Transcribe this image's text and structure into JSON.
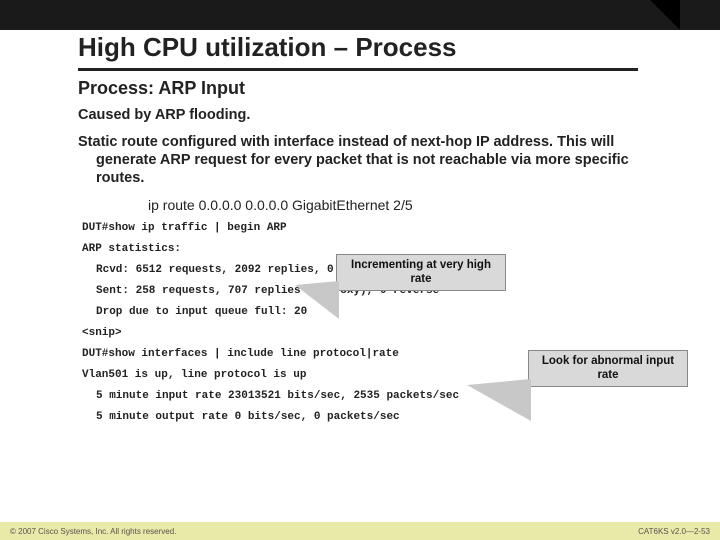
{
  "title": "High CPU utilization – Process",
  "subhead": "Process: ARP Input",
  "caused_by": "Caused by ARP flooding.",
  "static_route_para": "Static route configured with interface instead of next-hop IP address. This will generate ARP request for every packet that is not reachable via more specific routes.",
  "ip_route_cmd": "ip route 0.0.0.0 0.0.0.0 GigabitEthernet 2/5",
  "terminal": {
    "l1": "DUT#show ip traffic | begin ARP",
    "l2": "ARP statistics:",
    "l3": "Rcvd: 6512 requests, 2092 replies, 0 reverse, 0 other",
    "l4": "Sent: 258 requests, 707 replies (0 proxy), 0 reverse",
    "l5": "Drop due to input queue full: 20",
    "l6": "<snip>",
    "l7": "DUT#show interfaces | include line protocol|rate",
    "l8": "Vlan501 is up, line protocol is up",
    "l9": "5 minute input rate 23013521 bits/sec, 2535 packets/sec",
    "l10": "5 minute output rate 0 bits/sec, 0 packets/sec"
  },
  "callout1_line1": "Incrementing at very high",
  "callout1_line2": "rate",
  "callout2_line1": "Look for abnormal input",
  "callout2_line2": "rate",
  "footer_left": "© 2007 Cisco Systems, Inc. All rights reserved.",
  "footer_right": "CAT6KS v2.0—2-53"
}
